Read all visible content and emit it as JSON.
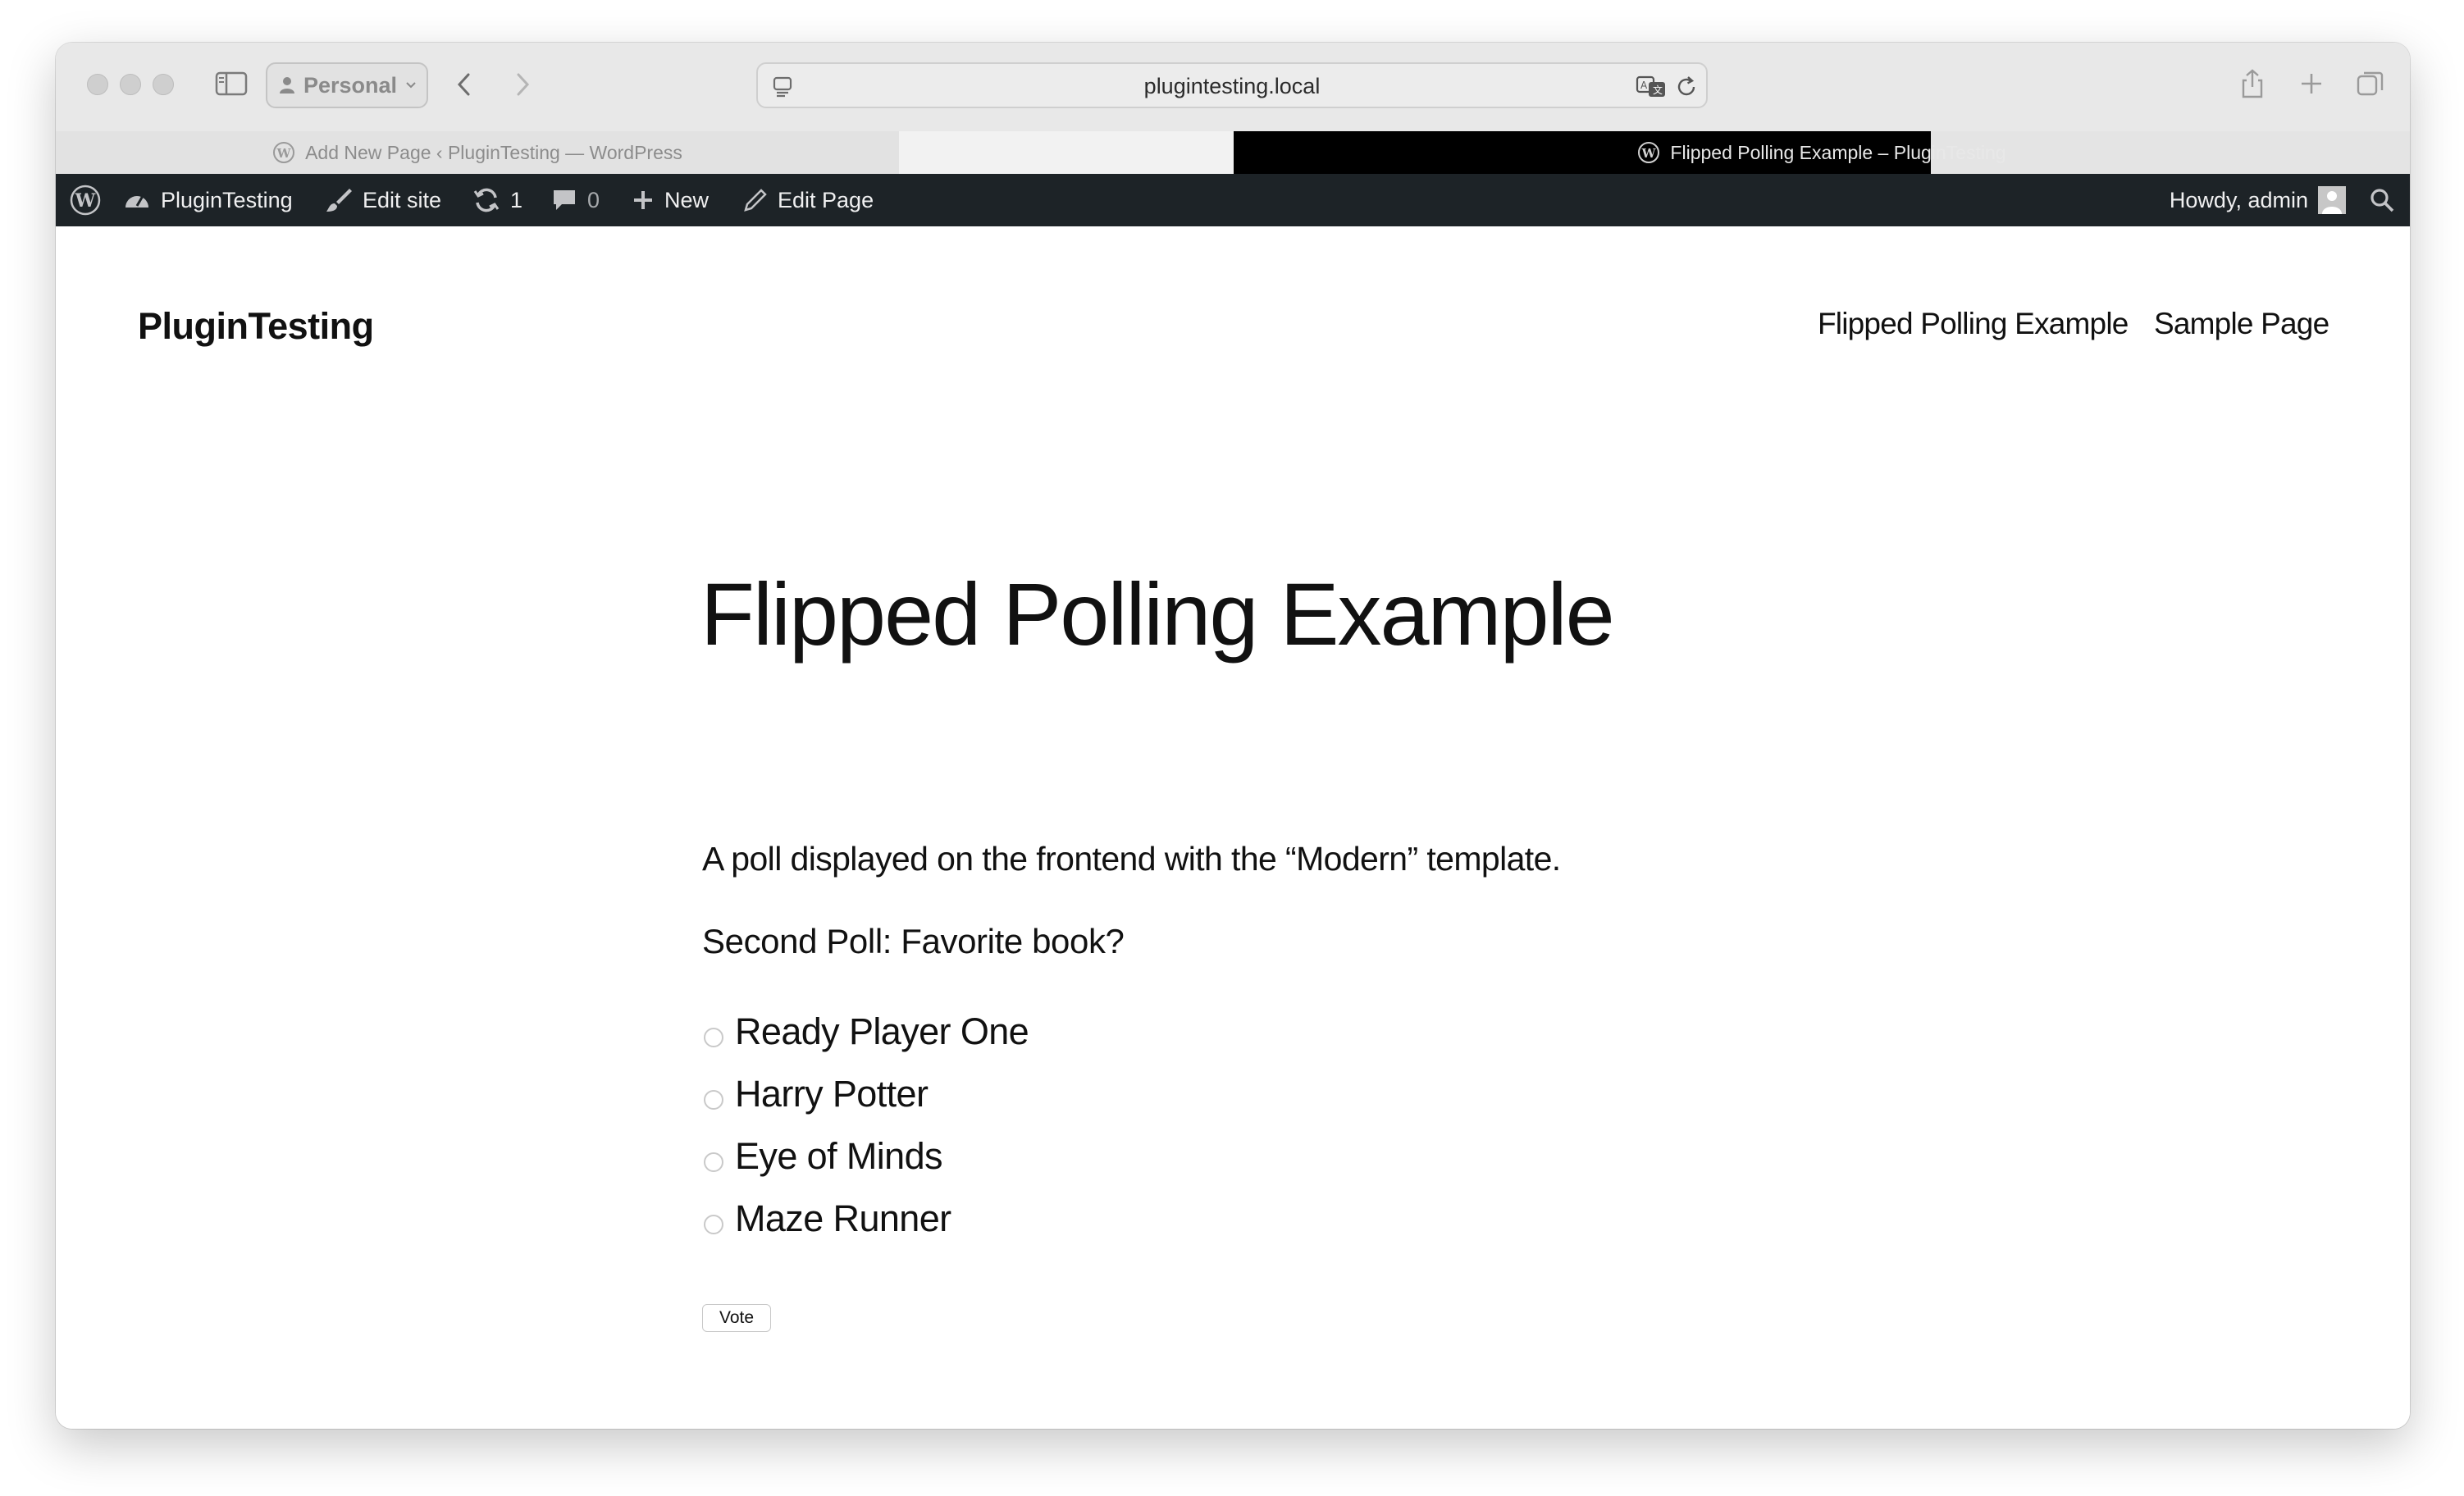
{
  "browser": {
    "profile_label": "Personal",
    "url": "plugintesting.local",
    "tabs": [
      {
        "title": "Add New Page ‹ PluginTesting — WordPress",
        "active": false
      },
      {
        "title": "Flipped Polling Example – PluginTesting",
        "active": true
      }
    ]
  },
  "admin_bar": {
    "site_name": "PluginTesting",
    "edit_site": "Edit site",
    "updates_count": "1",
    "comments_count": "0",
    "new_label": "New",
    "edit_page": "Edit Page",
    "howdy": "Howdy, admin"
  },
  "site": {
    "title": "PluginTesting",
    "nav": [
      "Flipped Polling Example",
      "Sample Page"
    ]
  },
  "post": {
    "title": "Flipped Polling Example",
    "intro": "A poll displayed on the frontend with the “Modern” template."
  },
  "poll": {
    "question": "Second Poll: Favorite book?",
    "options": [
      "Ready Player One",
      "Harry Potter",
      "Eye of Minds",
      "Maze Runner"
    ],
    "vote_label": "Vote"
  }
}
